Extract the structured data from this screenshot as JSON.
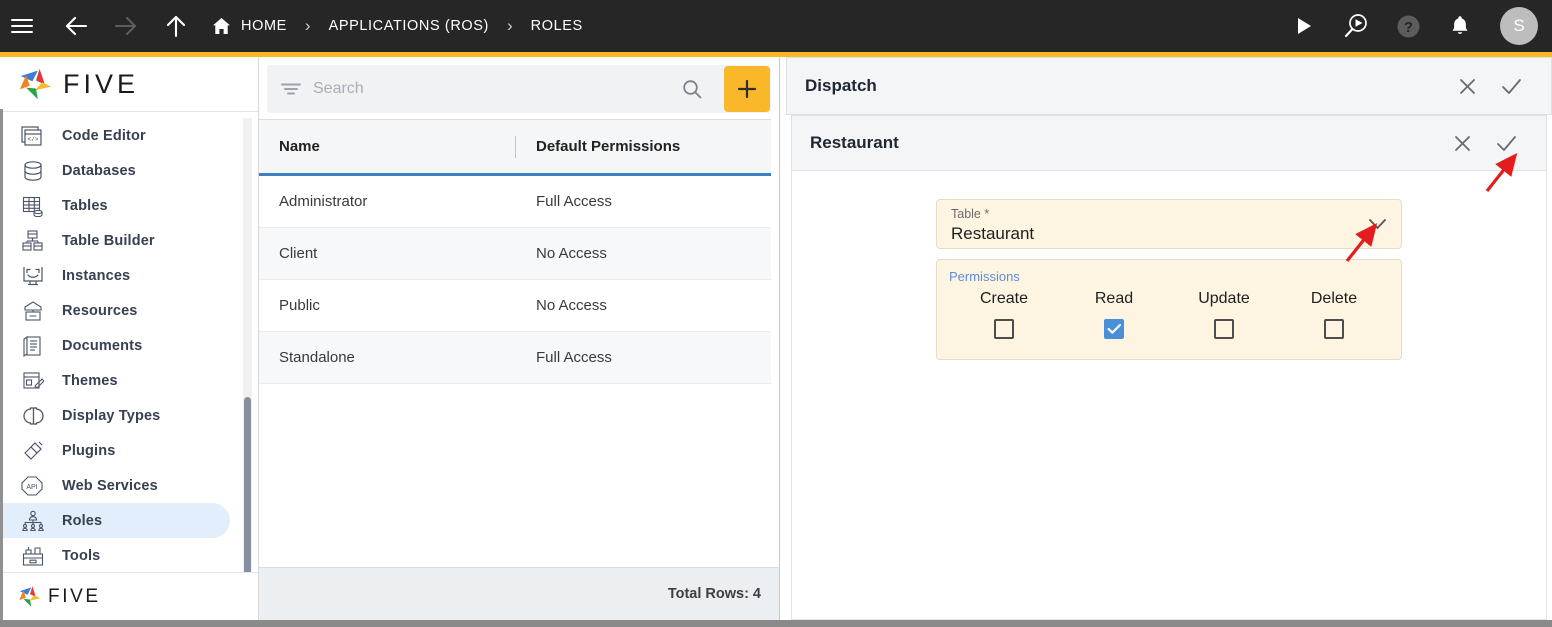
{
  "topbar": {
    "menu_icon": "hamburger-icon",
    "back_icon": "arrow-left-icon",
    "forward_icon": "arrow-right-icon",
    "up_icon": "arrow-up-icon",
    "home_icon": "home-icon",
    "breadcrumb": [
      {
        "label": "HOME",
        "icon": "home-icon"
      },
      {
        "label": "APPLICATIONS (ROS)",
        "icon": ""
      },
      {
        "label": "ROLES",
        "icon": ""
      }
    ],
    "separator": "›",
    "actions": [
      {
        "name": "run-button",
        "icon": "play-icon"
      },
      {
        "name": "debug-run-button",
        "icon": "magnifier-play-icon"
      },
      {
        "name": "help-button",
        "icon": "question-circle-icon"
      },
      {
        "name": "notifications-button",
        "icon": "bell-icon"
      }
    ],
    "avatar_initial": "S",
    "accent_color": "#fbb724"
  },
  "sidebar": {
    "logo_text": "FIVE",
    "footer_logo_text": "FIVE",
    "items": [
      {
        "label": "Code Editor",
        "icon": "code-editor-icon",
        "active": false
      },
      {
        "label": "Databases",
        "icon": "database-icon",
        "active": false
      },
      {
        "label": "Tables",
        "icon": "table-icon",
        "active": false
      },
      {
        "label": "Table Builder",
        "icon": "table-builder-icon",
        "active": false
      },
      {
        "label": "Instances",
        "icon": "instances-icon",
        "active": false
      },
      {
        "label": "Resources",
        "icon": "resources-icon",
        "active": false
      },
      {
        "label": "Documents",
        "icon": "documents-icon",
        "active": false
      },
      {
        "label": "Themes",
        "icon": "themes-icon",
        "active": false
      },
      {
        "label": "Display Types",
        "icon": "display-types-icon",
        "active": false
      },
      {
        "label": "Plugins",
        "icon": "plugins-icon",
        "active": false
      },
      {
        "label": "Web Services",
        "icon": "api-icon",
        "active": false
      },
      {
        "label": "Roles",
        "icon": "roles-icon",
        "active": true
      },
      {
        "label": "Tools",
        "icon": "tools-icon",
        "active": false
      }
    ],
    "active_highlight_color": "#e2eefb"
  },
  "list_panel": {
    "search": {
      "placeholder": "Search",
      "value": ""
    },
    "filter_icon": "filter-icon",
    "search_icon": "search-icon",
    "add_label": "+",
    "add_color": "#f9b829",
    "columns": [
      "Name",
      "Default Permissions"
    ],
    "rows": [
      {
        "name": "Administrator",
        "permissions": "Full Access"
      },
      {
        "name": "Client",
        "permissions": "No Access"
      },
      {
        "name": "Public",
        "permissions": "No Access"
      },
      {
        "name": "Standalone",
        "permissions": "Full Access"
      }
    ],
    "footer_text": "Total Rows: 4"
  },
  "right_panel": {
    "outer": {
      "title": "Dispatch",
      "close_icon": "close-icon",
      "confirm_icon": "check-icon"
    },
    "inner": {
      "title": "Restaurant",
      "close_icon": "close-icon",
      "confirm_icon": "check-icon"
    },
    "form": {
      "table_field": {
        "label": "Table *",
        "value": "Restaurant",
        "dropdown_icon": "chevron-down-icon"
      },
      "permissions": {
        "legend": "Permissions",
        "legend_color": "#5b8fd4",
        "checked_color": "#4a90d9",
        "options": [
          {
            "label": "Create",
            "checked": false
          },
          {
            "label": "Read",
            "checked": true
          },
          {
            "label": "Update",
            "checked": false
          },
          {
            "label": "Delete",
            "checked": false
          }
        ]
      },
      "field_background": "#fdf5e2"
    }
  },
  "annotations": [
    {
      "name": "arrow-to-confirm-icon",
      "color": "#e31d1d"
    },
    {
      "name": "arrow-to-table-dropdown",
      "color": "#e31d1d"
    }
  ]
}
